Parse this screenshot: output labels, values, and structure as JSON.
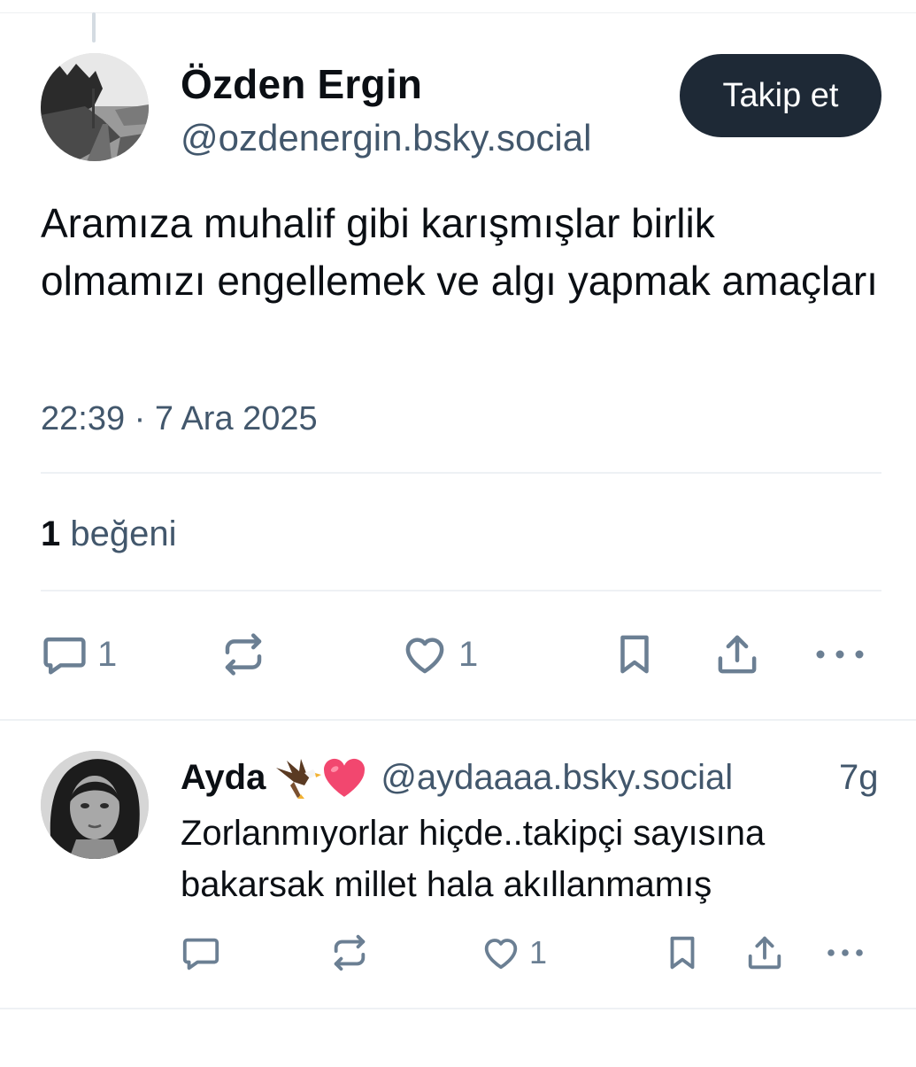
{
  "post": {
    "author_name": "Özden Ergin",
    "author_handle": "@ozdenergin.bsky.social",
    "follow_label": "Takip et",
    "text": "Aramıza muhalif gibi karışmışlar birlik olmamızı engellemek ve algı yapmak amaçları",
    "timestamp": "22:39 · 7 Ara 2025",
    "likes_number": "1",
    "likes_label": "beğeni",
    "actions": {
      "reply_count": "1",
      "like_count": "1"
    }
  },
  "reply": {
    "author_name": "Ayda",
    "author_handle": "@aydaaaa.bsky.social",
    "age": "7g",
    "text": "Zorlanmıyorlar hiçde..takipçi sayısına bakarsak millet hala akıllanmamış",
    "actions": {
      "like_count": "1"
    }
  },
  "icons": {
    "reply": "speech-bubble-icon",
    "repost": "repost-arrows-icon",
    "like": "heart-icon",
    "bookmark": "bookmark-icon",
    "share": "share-upload-icon",
    "more": "ellipsis-icon"
  },
  "colors": {
    "follow_button_bg": "#1e2936",
    "secondary_text": "#42576c",
    "icon_color": "#6b7f93"
  }
}
